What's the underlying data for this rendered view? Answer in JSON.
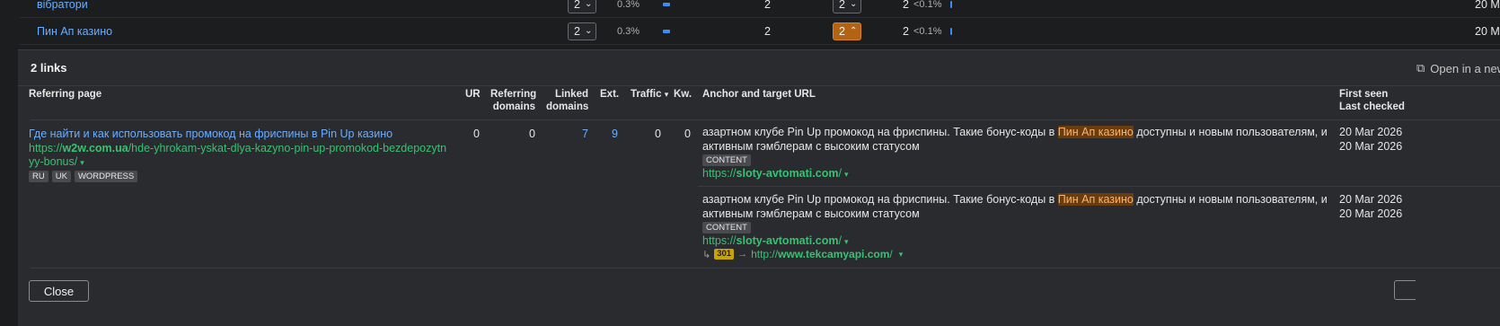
{
  "keyword_rows": [
    {
      "keyword": "вібратори",
      "position": "2",
      "share": "0.3%",
      "kd": "2",
      "position2": "2",
      "count": "2",
      "pct2": "<0.1%",
      "right": "20 M",
      "active": false
    },
    {
      "keyword": "Пин Ап казино",
      "position": "2",
      "share": "0.3%",
      "kd": "2",
      "position2": "2",
      "count": "2",
      "pct2": "<0.1%",
      "right": "20 M",
      "active": true
    }
  ],
  "panel": {
    "title": "2 links",
    "open_link": "Open in a new",
    "headers": {
      "referring_page": "Referring page",
      "ur": "UR",
      "referring_domains_1": "Referring",
      "referring_domains_2": "domains",
      "linked_domains_1": "Linked",
      "linked_domains_2": "domains",
      "ext": "Ext.",
      "traffic": "Traffic",
      "kw": "Kw.",
      "anchor": "Anchor and target URL",
      "first_seen": "First seen",
      "last_checked": "Last checked"
    },
    "row": {
      "title": "Где найти и как использовать промокод на фриспины в Pin Up казино",
      "url_prefix": "https://",
      "url_domain": "w2w.com.ua",
      "url_path": "/hde-yhrokam-yskat-dlya-kazyno-pin-up-promokod-bezdepozytnyy-bonus/",
      "tags": [
        "RU",
        "UK",
        "WORDPRESS"
      ],
      "ur": "0",
      "referring_domains": "0",
      "linked_domains": "7",
      "ext": "9",
      "traffic": "0",
      "kw": "0"
    },
    "anchors": [
      {
        "text_before": "азартном клубе Pin Up промокод на фриспины. Такие бонус-коды в ",
        "highlight": "Пин Ап казино",
        "text_after": " доступны и новым пользователям, и активным гэмблерам с высоким статусом",
        "tag": "CONTENT",
        "target_prefix": "https://",
        "target_domain": "sloty-avtomati.com",
        "target_suffix": "/",
        "first_seen": "20 Mar 2026",
        "last_checked": "20 Mar 2026"
      },
      {
        "text_before": "азартном клубе Pin Up промокод на фриспины. Такие бонус-коды в ",
        "highlight": "Пин Ап казино",
        "text_after": " доступны и новым пользователям, и активным гэмблерам с высоким статусом",
        "tag": "CONTENT",
        "target_prefix": "https://",
        "target_domain": "sloty-avtomati.com",
        "target_suffix": "/",
        "redirect_code": "301",
        "redirect_prefix": "http://",
        "redirect_domain": "www.tekcamyapi.com",
        "redirect_suffix": "/",
        "first_seen": "20 Mar 2026",
        "last_checked": "20 Mar 2026"
      }
    ],
    "close_label": "Close"
  },
  "colors": {
    "link": "#6aaeff",
    "url": "#38c173",
    "highlight": "#b36314",
    "badge": "#c9a300"
  }
}
